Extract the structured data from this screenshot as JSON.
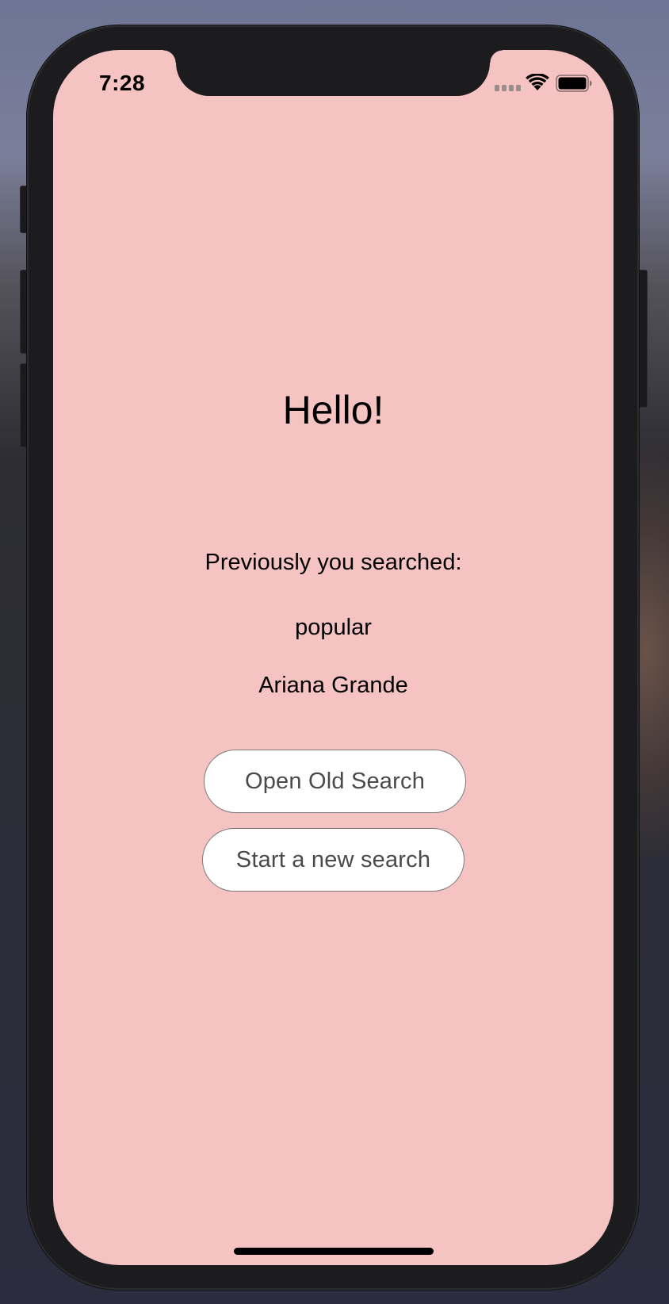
{
  "status_bar": {
    "time": "7:28",
    "signal_icon": "cellular-signal-icon",
    "wifi_icon": "wifi-icon",
    "battery_icon": "battery-full-icon"
  },
  "main": {
    "greeting": "Hello!",
    "previous_label": "Previously you searched:",
    "previous_searches": [
      "popular",
      "Ariana Grande"
    ],
    "open_old_search_label": "Open Old Search",
    "new_search_label": "Start a new search"
  },
  "colors": {
    "screen_background": "#f5c3c1",
    "button_background": "#ffffff",
    "button_text": "#4a4a4a"
  }
}
